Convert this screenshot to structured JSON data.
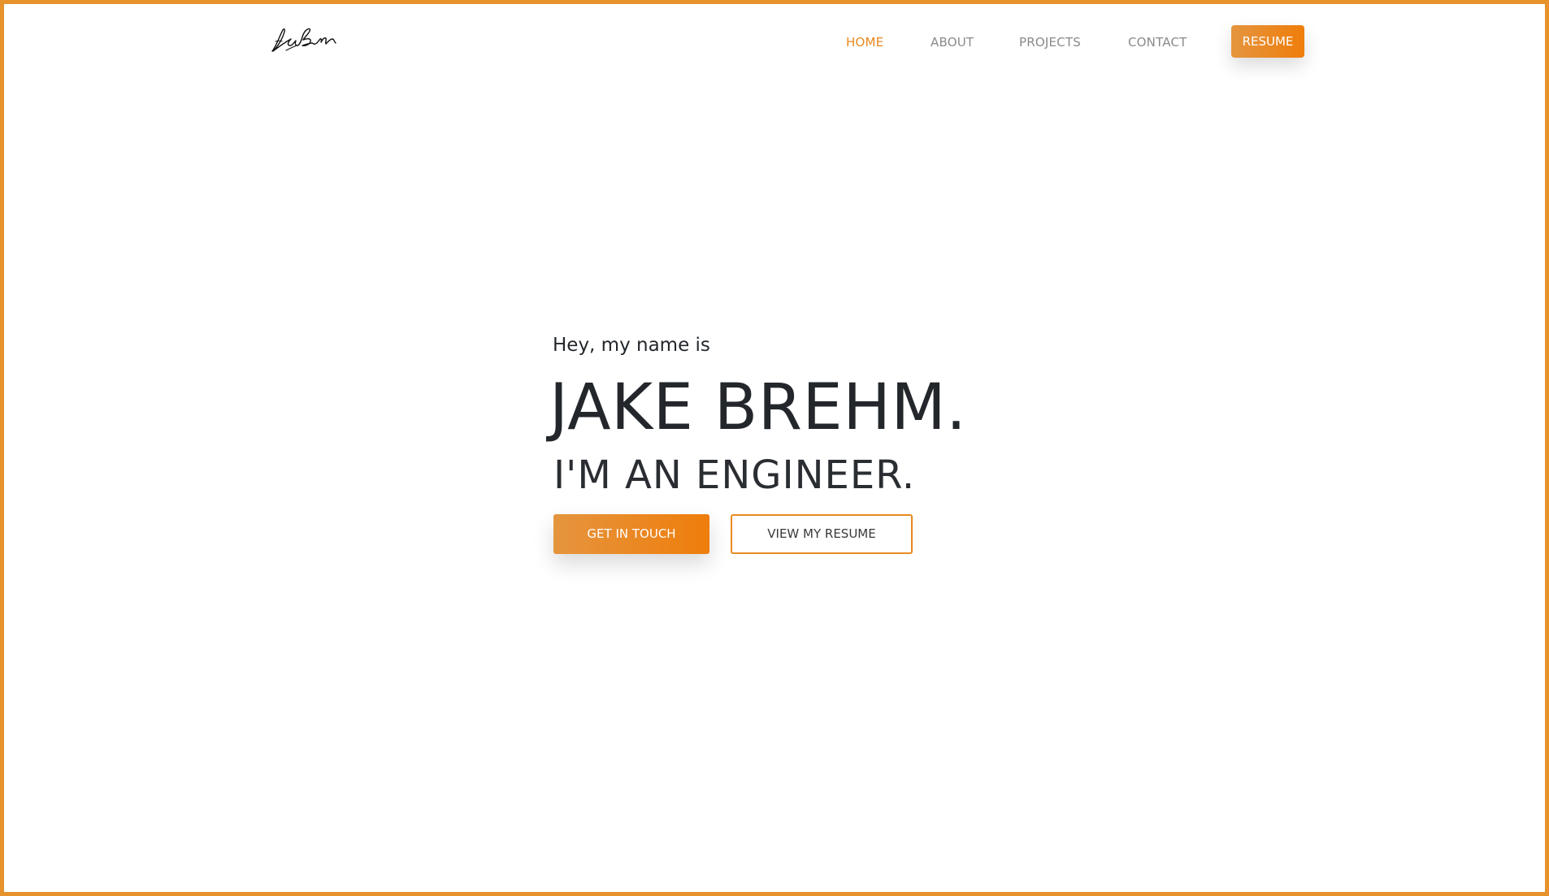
{
  "brand": {
    "logo_text": "Jacob Brehm"
  },
  "nav": {
    "items": [
      {
        "label": "HOME",
        "active": true
      },
      {
        "label": "ABOUT",
        "active": false
      },
      {
        "label": "PROJECTS",
        "active": false
      },
      {
        "label": "CONTACT",
        "active": false
      }
    ],
    "resume_label": "RESUME"
  },
  "hero": {
    "intro": "Hey, my name is",
    "name": "JAKE BREHM.",
    "role": "I'M AN ENGINEER.",
    "primary_cta": "GET IN TOUCH",
    "secondary_cta": "VIEW MY RESUME"
  },
  "colors": {
    "accent": "#e8891f",
    "accent_gradient_start": "#e5953f",
    "accent_gradient_end": "#ef7d0b",
    "text_dark": "#23272b",
    "nav_text": "#8a8a8a",
    "border": "#e8922c"
  }
}
